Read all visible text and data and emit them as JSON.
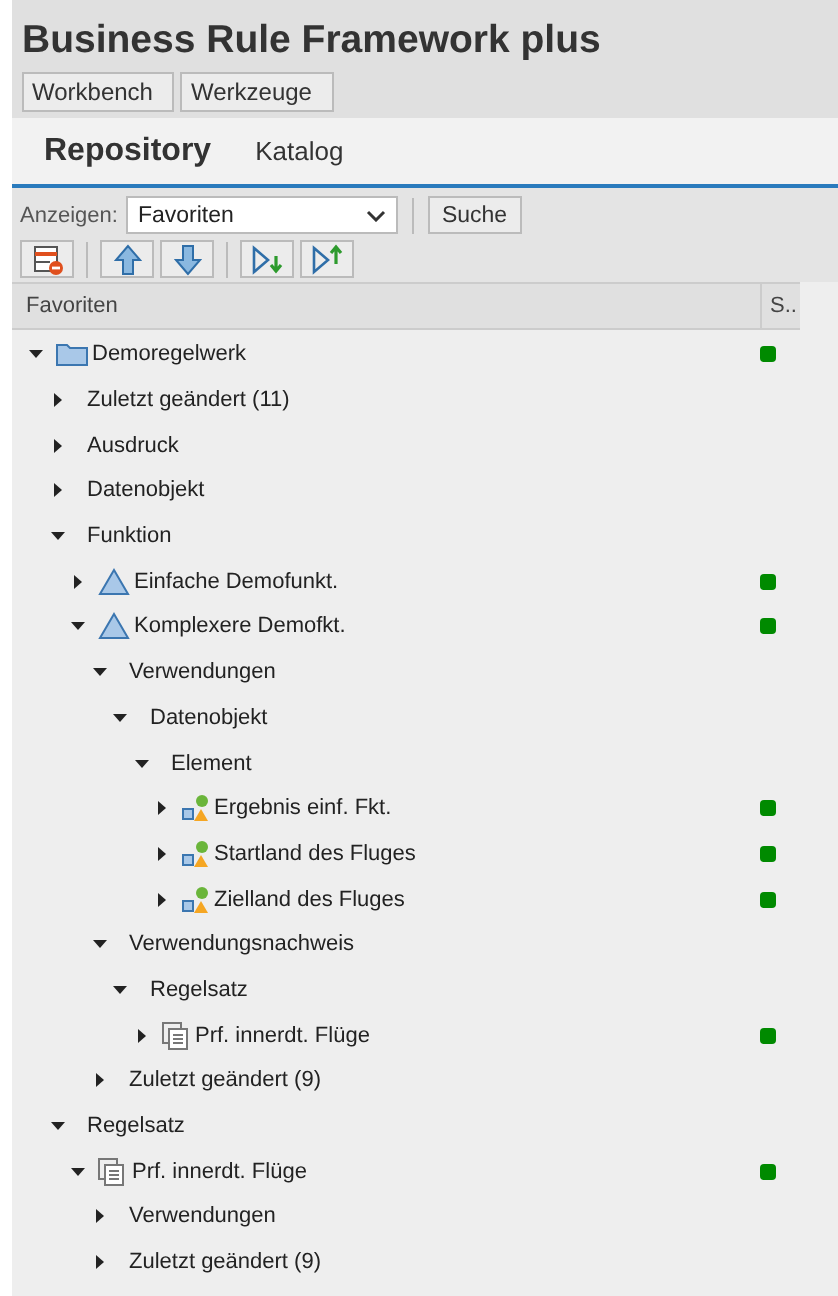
{
  "title": "Business Rule Framework plus",
  "menu_buttons": [
    "Workbench",
    "Werkzeuge"
  ],
  "tabs": [
    {
      "label": "Repository",
      "selected": true
    },
    {
      "label": "Katalog",
      "selected": false
    }
  ],
  "filter": {
    "label": "Anzeigen:",
    "value": "Favoriten",
    "button": "Suche"
  },
  "toolbar": [
    {
      "kind": "remove-list"
    },
    {
      "kind": "up"
    },
    {
      "kind": "down"
    },
    {
      "kind": "expand"
    },
    {
      "kind": "collapse"
    }
  ],
  "columns": [
    "Favoriten",
    "S.."
  ],
  "tree": [
    {
      "label": "Demoregelwerk",
      "kind": "folder",
      "expanded": true,
      "color": "#008a00",
      "children": [
        {
          "label": "Zuletzt geändert (11)",
          "expanded": false
        },
        {
          "label": "Ausdruck",
          "expanded": false
        },
        {
          "label": "Datenobjekt",
          "expanded": false
        },
        {
          "label": "Funktion",
          "expanded": true,
          "children": [
            {
              "label": "Einfache Demofunkt.",
              "kind": "function",
              "expanded": false,
              "color": "#008a00"
            },
            {
              "label": "Komplexere Demofkt.",
              "kind": "function",
              "expanded": true,
              "color": "#008a00",
              "children": [
                {
                  "label": "Verwendungen",
                  "expanded": true,
                  "children": [
                    {
                      "label": "Datenobjekt",
                      "expanded": true,
                      "children": [
                        {
                          "label": "Element",
                          "expanded": true,
                          "children": [
                            {
                              "label": "Ergebnis einf. Fkt.",
                              "kind": "element",
                              "expanded": false,
                              "color": "#008a00"
                            },
                            {
                              "label": "Startland des Fluges",
                              "kind": "element",
                              "expanded": false,
                              "color": "#008a00"
                            },
                            {
                              "label": "Zielland des Fluges",
                              "kind": "element",
                              "expanded": false,
                              "color": "#008a00"
                            }
                          ]
                        }
                      ]
                    }
                  ]
                },
                {
                  "label": "Verwendungsnachweis",
                  "expanded": true,
                  "children": [
                    {
                      "label": "Regelsatz",
                      "expanded": true,
                      "children": [
                        {
                          "label": "Prf. innerdt. Flüge",
                          "kind": "ruleset",
                          "expanded": false,
                          "color": "#008a00"
                        }
                      ]
                    }
                  ]
                },
                {
                  "label": "Zuletzt geändert (9)",
                  "expanded": false
                }
              ]
            }
          ]
        },
        {
          "label": "Regelsatz",
          "expanded": true,
          "children": [
            {
              "label": "Prf. innerdt. Flüge",
              "kind": "ruleset",
              "expanded": true,
              "color": "#008a00",
              "children": [
                {
                  "label": "Verwendungen",
                  "expanded": false
                },
                {
                  "label": "Zuletzt geändert (9)",
                  "expanded": false
                }
              ]
            }
          ]
        }
      ]
    }
  ]
}
